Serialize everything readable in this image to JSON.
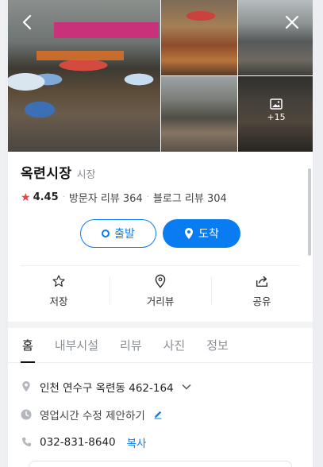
{
  "gallery": {
    "more_count": "+15"
  },
  "place": {
    "name": "옥련시장",
    "category": "시장",
    "rating": "4.45",
    "visitor_reviews": "방문자 리뷰 364",
    "blog_reviews": "블로그 리뷰 304"
  },
  "route": {
    "depart_label": "출발",
    "arrive_label": "도착"
  },
  "actions": {
    "save_label": "저장",
    "street_view_label": "거리뷰",
    "share_label": "공유"
  },
  "tabs": [
    {
      "label": "홈"
    },
    {
      "label": "내부시설"
    },
    {
      "label": "리뷰"
    },
    {
      "label": "사진"
    },
    {
      "label": "정보"
    }
  ],
  "info": {
    "address": "인천 연수구 옥련동 462-164",
    "hours_suggestion": "영업시간 수정 제안하기",
    "phone": "032-831-8640",
    "copy_label": "복사"
  },
  "colors": {
    "accent": "#0a7cf2",
    "star": "#e94040"
  }
}
